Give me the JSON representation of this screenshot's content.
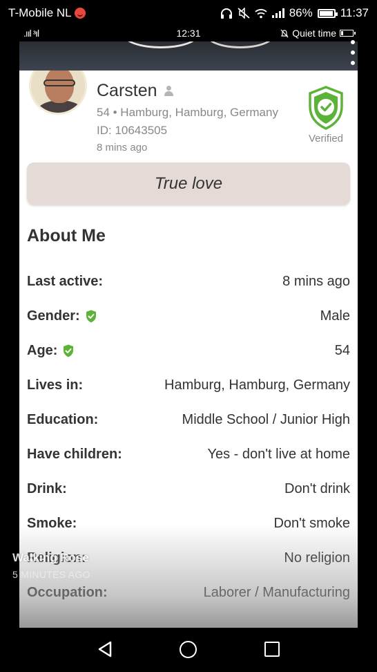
{
  "outer_status": {
    "carrier": "T-Mobile  NL",
    "battery": "86%",
    "battery_level": 0.86,
    "time": "11:37",
    "icons": [
      "headphones-icon",
      "mute-icon",
      "wifi-icon",
      "signal-icon",
      "battery-icon"
    ]
  },
  "inner_status": {
    "signal": ".ııl ᵌıl",
    "time": "12:31",
    "quiet_time": "Quiet time",
    "battery_level": 0.15
  },
  "profile": {
    "name": "Carsten",
    "location": "54 • Hamburg, Hamburg, Germany",
    "id": "ID: 10643505",
    "last_seen": "8 mins ago",
    "verified_label": "Verified",
    "verified_color": "#5cb338",
    "tagline": "True love"
  },
  "about": {
    "title": "About Me",
    "rows": [
      {
        "label": "Last active:",
        "value": "8 mins ago",
        "verified": false
      },
      {
        "label": "Gender:",
        "value": "Male",
        "verified": true
      },
      {
        "label": "Age:",
        "value": "54",
        "verified": true
      },
      {
        "label": "Lives in:",
        "value": "Hamburg, Hamburg, Germany",
        "verified": false
      },
      {
        "label": "Education:",
        "value": "Middle School / Junior High",
        "verified": false
      },
      {
        "label": "Have children:",
        "value": "Yes - don't live at home",
        "verified": false
      },
      {
        "label": "Drink:",
        "value": "Don't drink",
        "verified": false
      },
      {
        "label": "Smoke:",
        "value": "Don't smoke",
        "verified": false
      },
      {
        "label": "Religion:",
        "value": "No religion",
        "verified": false
      },
      {
        "label": "Occupation:",
        "value": "Laborer / Manufacturing",
        "verified": false
      }
    ]
  },
  "overlay": {
    "author": "Walking Rose",
    "time": "5 MINUTES AGO"
  }
}
